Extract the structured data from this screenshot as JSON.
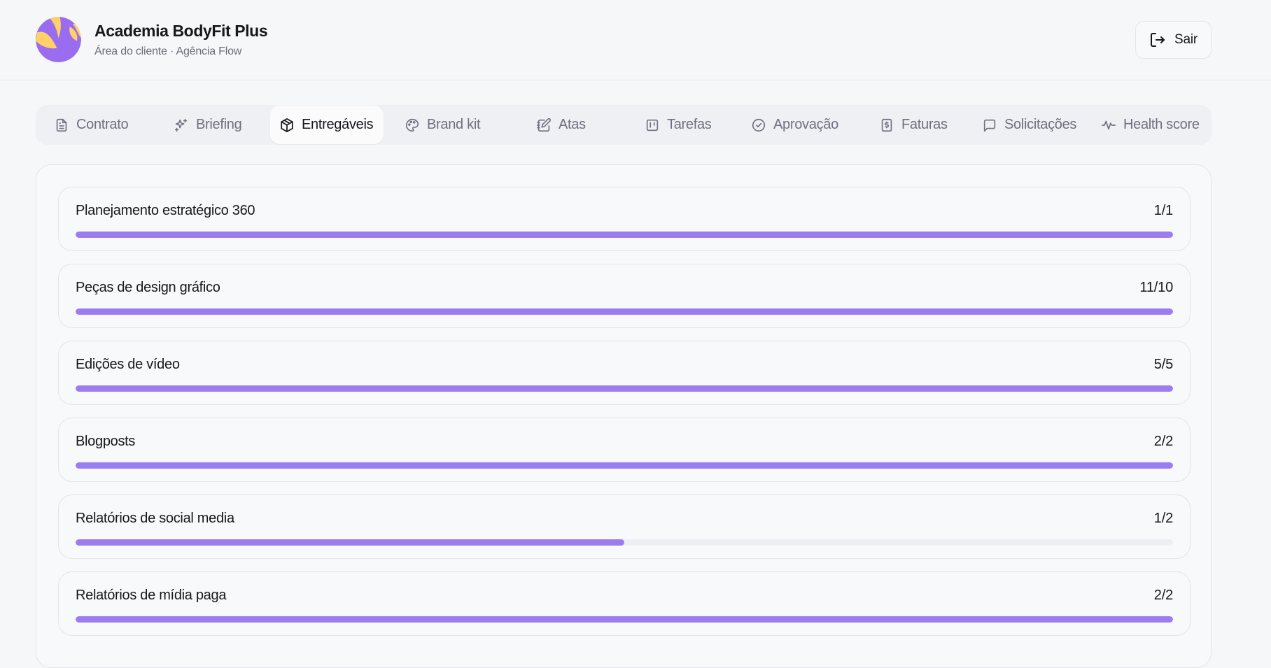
{
  "header": {
    "title": "Academia BodyFit Plus",
    "subtitle": "Área do cliente · Agência Flow",
    "logout_label": "Sair"
  },
  "tabs": [
    {
      "label": "Contrato",
      "icon": "file-icon",
      "active": false
    },
    {
      "label": "Briefing",
      "icon": "sparkles-icon",
      "active": false
    },
    {
      "label": "Entregáveis",
      "icon": "package-icon",
      "active": true
    },
    {
      "label": "Brand kit",
      "icon": "palette-icon",
      "active": false
    },
    {
      "label": "Atas",
      "icon": "notebook-pen-icon",
      "active": false
    },
    {
      "label": "Tarefas",
      "icon": "kanban-icon",
      "active": false
    },
    {
      "label": "Aprovação",
      "icon": "check-circle-icon",
      "active": false
    },
    {
      "label": "Faturas",
      "icon": "receipt-dollar-icon",
      "active": false
    },
    {
      "label": "Solicitações",
      "icon": "message-square-icon",
      "active": false
    },
    {
      "label": "Health score",
      "icon": "activity-icon",
      "active": false
    }
  ],
  "deliverables": [
    {
      "name": "Planejamento estratégico 360",
      "count": "1/1",
      "progress": 1.0
    },
    {
      "name": "Peças de design gráfico",
      "count": "11/10",
      "progress": 1.0
    },
    {
      "name": "Edições de vídeo",
      "count": "5/5",
      "progress": 1.0
    },
    {
      "name": "Blogposts",
      "count": "2/2",
      "progress": 1.0
    },
    {
      "name": "Relatórios de social media",
      "count": "1/2",
      "progress": 0.5
    },
    {
      "name": "Relatórios de mídia paga",
      "count": "2/2",
      "progress": 1.0
    }
  ],
  "colors": {
    "accent": "#9b7df0",
    "logo_purple": "#9a6cf0",
    "logo_yellow": "#ffd166",
    "track": "#eeeff3"
  }
}
